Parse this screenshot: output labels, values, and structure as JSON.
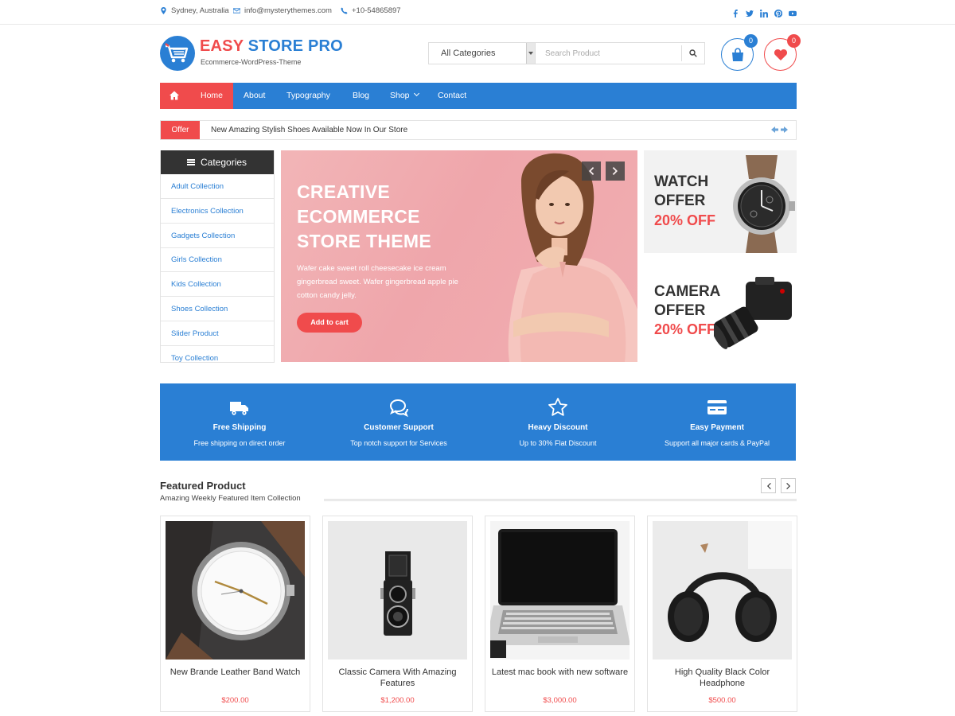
{
  "topbar": {
    "location": "Sydney, Australia",
    "email": "info@mysterythemes.com",
    "phone": "+10-54865897",
    "socials": [
      "facebook-icon",
      "twitter-icon",
      "linkedin-icon",
      "pinterest-icon",
      "youtube-icon"
    ]
  },
  "header": {
    "brand_part1": "EASY",
    "brand_part2": "STORE PRO",
    "tagline": "Ecommerce-WordPress-Theme",
    "category_select": "All Categories",
    "search_placeholder": "Search Product",
    "cart_count": "0",
    "wishlist_count": "0"
  },
  "nav": {
    "items": [
      "Home",
      "About",
      "Typography",
      "Blog",
      "Shop",
      "Contact"
    ],
    "active": "Home"
  },
  "ticker": {
    "label": "Offer",
    "message": "New Amazing Stylish Shoes Available Now In Our Store"
  },
  "categories": {
    "heading": "Categories",
    "items": [
      "Adult Collection",
      "Electronics Collection",
      "Gadgets Collection",
      "Girls Collection",
      "Kids Collection",
      "Shoes Collection",
      "Slider Product",
      "Toy Collection"
    ]
  },
  "hero": {
    "title_line1": "CREATIVE",
    "title_line2": "ECOMMERCE",
    "title_line3": "STORE THEME",
    "text": "Wafer cake sweet roll cheesecake ice cream gingerbread sweet. Wafer gingerbread apple pie cotton candy jelly.",
    "button": "Add to cart"
  },
  "offers": [
    {
      "line1": "WATCH",
      "line2": "OFFER",
      "discount": "20% OFF"
    },
    {
      "line1": "CAMERA",
      "line2": "OFFER",
      "discount": "20% OFF"
    }
  ],
  "features": [
    {
      "icon": "truck-icon",
      "title": "Free Shipping",
      "sub": "Free shipping on direct order"
    },
    {
      "icon": "chat-icon",
      "title": "Customer Support",
      "sub": "Top notch support for Services"
    },
    {
      "icon": "star-icon",
      "title": "Heavy Discount",
      "sub": "Up to 30% Flat Discount"
    },
    {
      "icon": "credit-card-icon",
      "title": "Easy Payment",
      "sub": "Support all major cards & PayPal"
    }
  ],
  "featured": {
    "title": "Featured Product",
    "subtitle": "Amazing Weekly Featured Item Collection",
    "products": [
      {
        "name": "New Brande Leather Band Watch",
        "price": "$200.00"
      },
      {
        "name": "Classic Camera With Amazing Features",
        "price": "$1,200.00"
      },
      {
        "name": "Latest mac book with new software",
        "price": "$3,000.00"
      },
      {
        "name": "High Quality Black Color Headphone",
        "price": "$500.00"
      }
    ]
  },
  "colors": {
    "primary": "#2a7fd4",
    "accent": "#f04b4c",
    "dark": "#333333"
  }
}
